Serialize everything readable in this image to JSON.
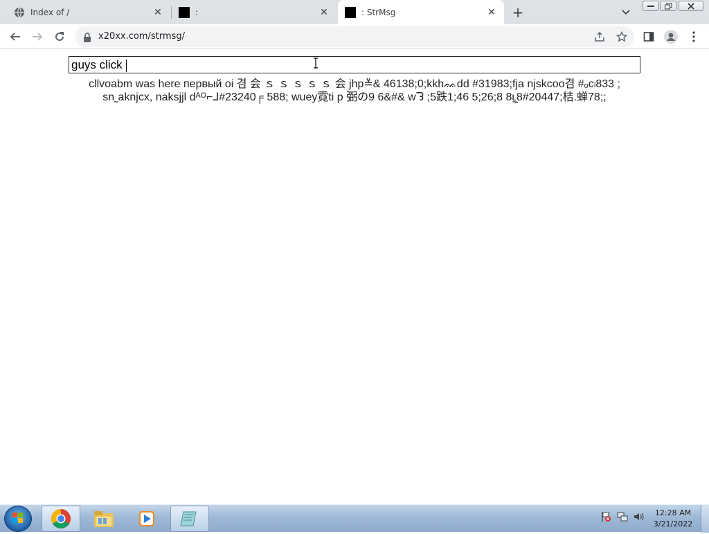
{
  "browser": {
    "tabs": [
      {
        "title": "Index of /",
        "icon": "globe-icon",
        "active": false
      },
      {
        "title": ":",
        "icon": "black-square-icon",
        "active": false
      },
      {
        "title": ": StrMsg",
        "icon": "black-square-icon",
        "active": true
      }
    ],
    "close_glyph": "✕",
    "new_tab_glyph": "+",
    "url": "x20xx.com/strmsg/"
  },
  "page": {
    "input_value": "guys click ",
    "messages_text": "cllvoabm was here первый oi 겸 会 ｓ ｓ ｓ ｓ  ｓ 会 jhp≚&  46138;0;kkhᨐdd  #31983;fja njskcᴏᴏ겸 #ₒcₗ833  ;  sn˷aknjcx,    naksjjl dᴬᴼ⌐⅃#23240╒   588;  wuey霓ti  p 弼の9  6&#& wᘊ  ;5跌1;46 5;26;8  8ʟ̠̤ͅ8#20447;桔.蝉78;;"
  },
  "taskbar": {
    "time": "12:28 AM",
    "date": "3/21/2022",
    "apps": [
      "chrome-icon",
      "file-explorer-icon",
      "media-player-icon",
      "notepad-icon"
    ]
  },
  "colors": {
    "tabstrip": "#dee1e6",
    "taskbar": "#9fb9d6",
    "text": "#222222"
  }
}
